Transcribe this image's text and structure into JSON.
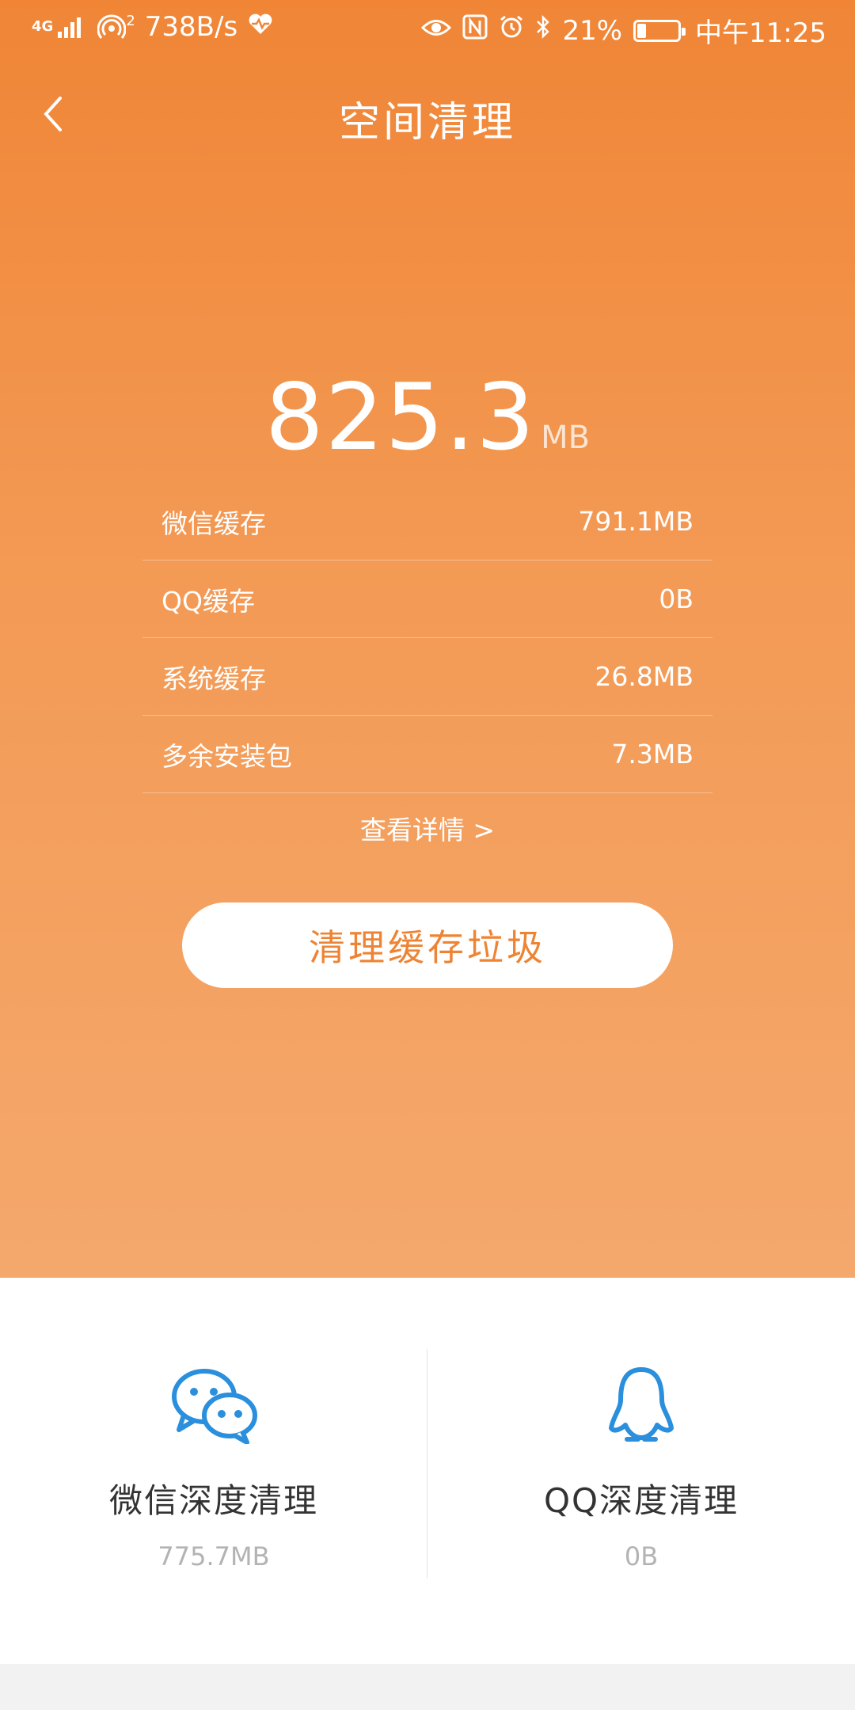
{
  "status_bar": {
    "network_type": "4G",
    "hotspot_count": "2",
    "speed": "738B/s",
    "battery_percent": "21%",
    "battery_level": 0.21,
    "time": "中午11:25",
    "icons": [
      "signal-icon",
      "hotspot-icon",
      "health-icon",
      "eye-icon",
      "nfc-icon",
      "alarm-icon",
      "bluetooth-icon",
      "battery-icon"
    ]
  },
  "header": {
    "title": "空间清理",
    "back_icon": "back-chevron-icon"
  },
  "summary": {
    "total_value": "825.3",
    "total_unit": "MB",
    "items": [
      {
        "label": "微信缓存",
        "value": "791.1MB"
      },
      {
        "label": "QQ缓存",
        "value": "0B"
      },
      {
        "label": "系统缓存",
        "value": "26.8MB"
      },
      {
        "label": "多余安装包",
        "value": "7.3MB"
      }
    ],
    "details_link": "查看详情 >",
    "clean_button": "清理缓存垃圾"
  },
  "deep_clean": {
    "wechat": {
      "title": "微信深度清理",
      "size": "775.7MB",
      "icon": "wechat-icon"
    },
    "qq": {
      "title": "QQ深度清理",
      "size": "0B",
      "icon": "qq-penguin-icon"
    }
  },
  "colors": {
    "accent": "#f08536",
    "button_text": "#ee8433",
    "icon_blue": "#2a8fdc"
  }
}
